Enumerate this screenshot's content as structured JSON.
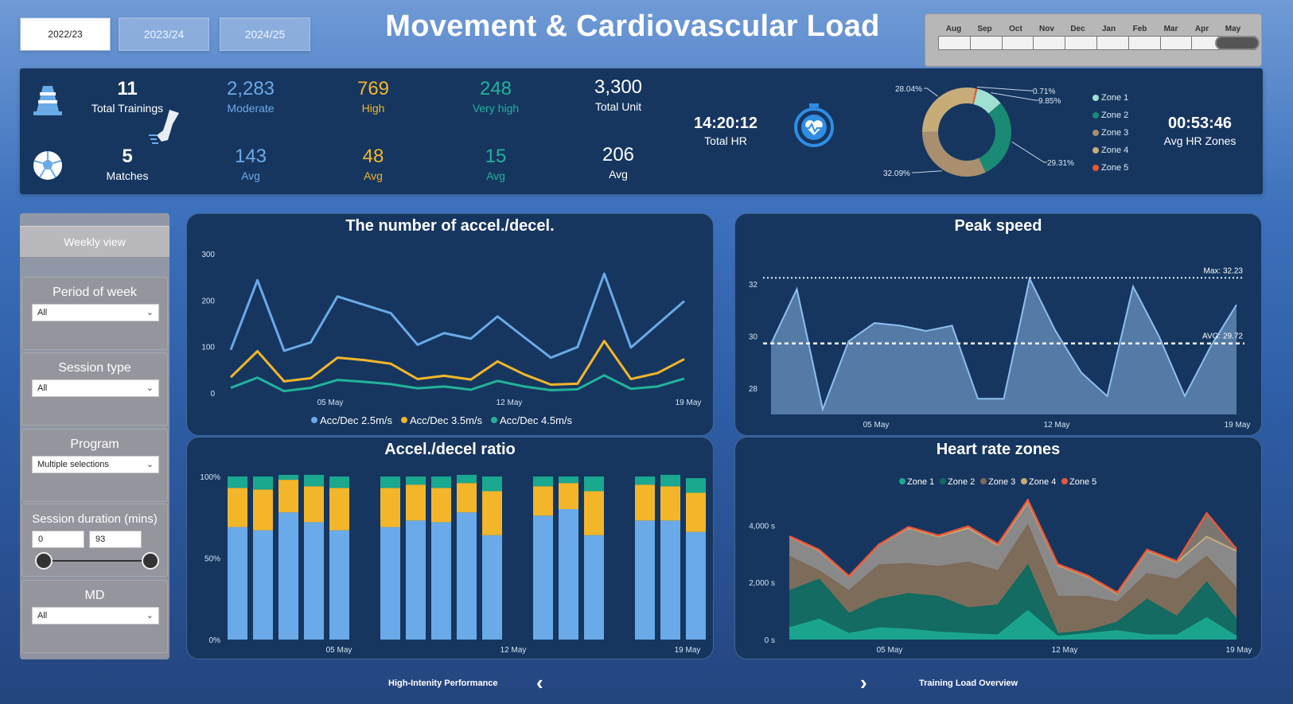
{
  "seasons": [
    "2022/23",
    "2023/24",
    "2024/25"
  ],
  "title": "Movement & Cardiovascular Load",
  "months": [
    "Aug",
    "Sep",
    "Oct",
    "Nov",
    "Dec",
    "Jan",
    "Feb",
    "Mar",
    "Apr",
    "May"
  ],
  "kpis": {
    "total_trainings": {
      "value": "11",
      "label": "Total Trainings"
    },
    "matches": {
      "value": "5",
      "label": "Matches"
    },
    "moderate": {
      "value": "2,283",
      "label": "Moderate",
      "avg": "143",
      "avg_label": "Avg"
    },
    "high": {
      "value": "769",
      "label": "High",
      "avg": "48",
      "avg_label": "Avg"
    },
    "very_high": {
      "value": "248",
      "label": "Very high",
      "avg": "15",
      "avg_label": "Avg"
    },
    "total_unit": {
      "value": "3,300",
      "label": "Total Unit",
      "avg": "206",
      "avg_label": "Avg"
    },
    "total_hr": {
      "value": "14:20:12",
      "label": "Total HR"
    },
    "avg_hr_zones": {
      "value": "00:53:46",
      "label": "Avg HR Zones"
    }
  },
  "donut": {
    "labels": [
      "0.71%",
      "9.85%",
      "29.31%",
      "32.09%",
      "28.04%"
    ],
    "zones": [
      {
        "name": "Zone 1",
        "color": "#9fe0d3"
      },
      {
        "name": "Zone 2",
        "color": "#1a8a74"
      },
      {
        "name": "Zone 3",
        "color": "#a98f6f"
      },
      {
        "name": "Zone 4",
        "color": "#c8ac78"
      },
      {
        "name": "Zone 5",
        "color": "#e8583a"
      }
    ]
  },
  "filters": {
    "weekly_view": "Weekly view",
    "period_of_week": {
      "title": "Period of week",
      "value": "All"
    },
    "session_type": {
      "title": "Session type",
      "value": "All"
    },
    "program": {
      "title": "Program",
      "value": "Multiple selections"
    },
    "session_duration": {
      "title": "Session duration (mins)",
      "min": "0",
      "max": "93"
    },
    "md": {
      "title": "MD",
      "value": "All"
    }
  },
  "nav": {
    "prev": "High-Intenity Performance",
    "next": "Training Load Overview"
  },
  "chart_data": [
    {
      "type": "line",
      "title": "The number of accel./decel.",
      "x_ticks": [
        "05 May",
        "12 May",
        "19 May"
      ],
      "y_ticks": [
        "0",
        "100",
        "200",
        "300"
      ],
      "ylim": [
        0,
        300
      ],
      "series": [
        {
          "name": "Acc/Dec 2.5m/s",
          "color": "#6aaae8",
          "values": [
            93,
            243,
            91,
            109,
            208,
            190,
            172,
            104,
            129,
            117,
            165,
            120,
            76,
            99,
            257,
            98,
            148,
            198
          ]
        },
        {
          "name": "Acc/Dec 3.5m/s",
          "color": "#f3b62a",
          "values": [
            34,
            90,
            25,
            32,
            76,
            71,
            63,
            30,
            37,
            29,
            68,
            40,
            18,
            20,
            112,
            30,
            43,
            73
          ]
        },
        {
          "name": "Acc/Dec 4.5m/s",
          "color": "#22b39a",
          "values": [
            11,
            33,
            4,
            11,
            28,
            24,
            19,
            10,
            14,
            7,
            26,
            14,
            6,
            8,
            38,
            9,
            14,
            31
          ]
        }
      ]
    },
    {
      "type": "area",
      "title": "Peak speed",
      "x_ticks": [
        "05 May",
        "12 May",
        "19 May"
      ],
      "y_ticks": [
        "28",
        "30",
        "32"
      ],
      "ylim": [
        27.0,
        33.0
      ],
      "max_label": "Max: 32.23",
      "avg_label": "AVG: 29.72",
      "max": 32.23,
      "avg": 29.72,
      "values": [
        29.7,
        31.8,
        27.2,
        29.8,
        30.5,
        30.4,
        30.2,
        30.4,
        27.6,
        27.6,
        32.2,
        30.2,
        28.6,
        27.7,
        31.9,
        30.0,
        27.7,
        29.6,
        31.2
      ]
    },
    {
      "type": "bar",
      "title": "Accel./decel ratio",
      "x_ticks": [
        "05 May",
        "12 May",
        "19 May"
      ],
      "y_ticks": [
        "0%",
        "50%",
        "100%"
      ],
      "bars": [
        {
          "gap_before": 0,
          "values": [
            0.69,
            0.24,
            0.07
          ]
        },
        {
          "gap_before": 0,
          "values": [
            0.67,
            0.25,
            0.08
          ]
        },
        {
          "gap_before": 0,
          "values": [
            0.78,
            0.2,
            0.03
          ]
        },
        {
          "gap_before": 0,
          "values": [
            0.72,
            0.22,
            0.07
          ]
        },
        {
          "gap_before": 0,
          "values": [
            0.67,
            0.26,
            0.07
          ]
        },
        {
          "gap_before": 1,
          "values": [
            0.69,
            0.24,
            0.07
          ]
        },
        {
          "gap_before": 0,
          "values": [
            0.73,
            0.22,
            0.05
          ]
        },
        {
          "gap_before": 0,
          "values": [
            0.72,
            0.21,
            0.07
          ]
        },
        {
          "gap_before": 0,
          "values": [
            0.78,
            0.18,
            0.05
          ]
        },
        {
          "gap_before": 0,
          "values": [
            0.64,
            0.27,
            0.09
          ]
        },
        {
          "gap_before": 1,
          "values": [
            0.76,
            0.18,
            0.06
          ]
        },
        {
          "gap_before": 0,
          "values": [
            0.8,
            0.16,
            0.04
          ]
        },
        {
          "gap_before": 0,
          "values": [
            0.64,
            0.27,
            0.09
          ]
        },
        {
          "gap_before": 1,
          "values": [
            0.73,
            0.22,
            0.05
          ]
        },
        {
          "gap_before": 0,
          "values": [
            0.73,
            0.21,
            0.07
          ]
        },
        {
          "gap_before": 0,
          "values": [
            0.66,
            0.24,
            0.09
          ]
        }
      ],
      "colors": [
        "#6aaae8",
        "#f3b62a",
        "#1aa88f"
      ]
    },
    {
      "type": "area",
      "title": "Heart rate zones",
      "x_ticks": [
        "05 May",
        "12 May",
        "19 May"
      ],
      "y_ticks": [
        "0 s",
        "2,000 s",
        "4,000 s"
      ],
      "ylim": [
        0,
        5400
      ],
      "legend": [
        "Zone 1",
        "Zone 2",
        "Zone 3",
        "Zone 4",
        "Zone 5"
      ],
      "stack_totals": [
        {
          "name": "Zone 1",
          "color": "#1aa88f",
          "values": [
            400,
            700,
            200,
            400,
            350,
            250,
            200,
            150,
            1000,
            100,
            200,
            300,
            150,
            150,
            750,
            100
          ]
        },
        {
          "name": "Zone 2",
          "color": "#0f6b62",
          "values": [
            1700,
            2100,
            900,
            1400,
            1600,
            1500,
            1100,
            1200,
            2600,
            200,
            300,
            600,
            1400,
            800,
            2000,
            700
          ]
        },
        {
          "name": "Zone 3",
          "color": "#7d6a57",
          "values": [
            2900,
            2400,
            1700,
            2600,
            2650,
            2550,
            2700,
            2400,
            4000,
            1500,
            1500,
            1300,
            2300,
            2100,
            2900,
            1800
          ]
        },
        {
          "name": "Zone 4",
          "color": "#8a8a8a",
          "values": [
            3600,
            3100,
            2200,
            3300,
            3900,
            3600,
            3900,
            3300,
            4800,
            2600,
            2200,
            1600,
            3100,
            2700,
            3600,
            3100
          ]
        },
        {
          "name": "Zone 5",
          "color": "#e8583a",
          "values": [
            3620,
            3140,
            2220,
            3320,
            3940,
            3640,
            3960,
            3340,
            4880,
            2640,
            2240,
            1640,
            3140,
            2740,
            4420,
            3160
          ]
        }
      ]
    }
  ]
}
